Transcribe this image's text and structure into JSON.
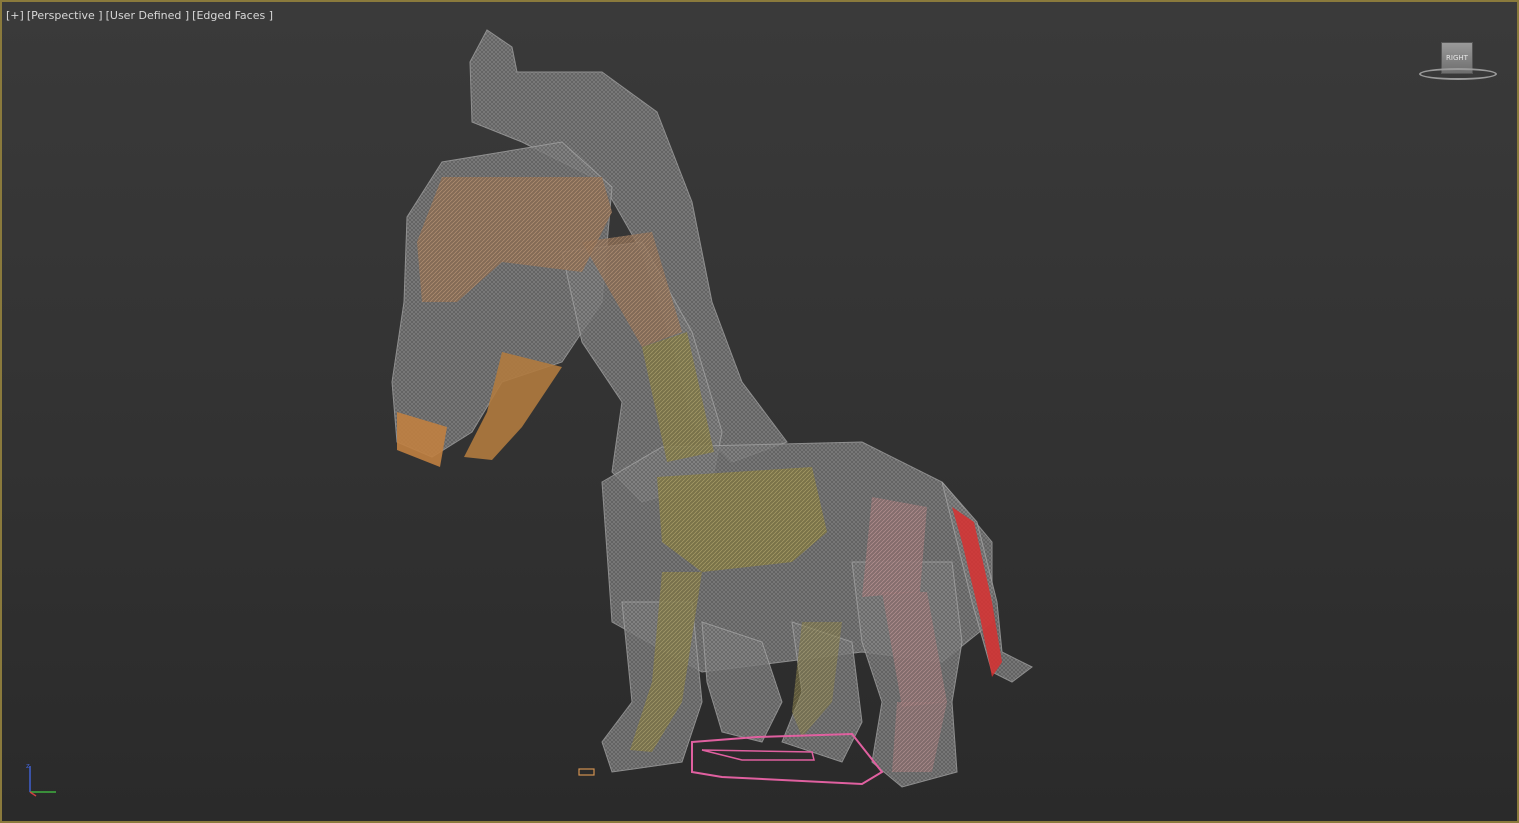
{
  "viewport": {
    "labels": [
      "[+]",
      "[Perspective ]",
      "[User Defined ]",
      "[Edged Faces ]"
    ],
    "active_border_color": "#8a7a3c",
    "background_top": "#3a3a3a",
    "background_bottom": "#2a2a2a"
  },
  "viewcube": {
    "face_label": "RIGHT",
    "icon": "viewcube-icon"
  },
  "model": {
    "name": "wireframe-horse",
    "display_mode": "Edged Faces",
    "colors": {
      "mesh": "#8c8c8c",
      "bone_head": "#b07a48",
      "bone_neck": "#a8924a",
      "bone_body": "#8e8433",
      "bone_hind": "#b08080",
      "bone_tail": "#d83030",
      "ik_target": "#e060a0"
    }
  },
  "axis_gizmo": {
    "x_color": "#d04040",
    "y_color": "#40b040",
    "z_color": "#4060d0",
    "z_label": "z"
  }
}
